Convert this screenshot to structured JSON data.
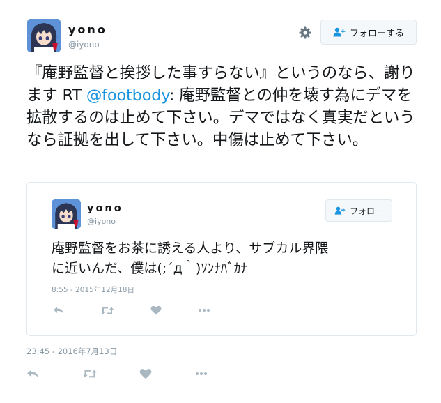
{
  "tweet": {
    "user": {
      "name": "yono",
      "handle": "@iyono"
    },
    "follow_label": "フォローする",
    "text_before_mention": "『庵野監督と挨拶した事すらない』というのなら、謝ります RT ",
    "mention": "@footbody",
    "text_after_mention": ": 庵野監督との仲を壊す為にデマを拡散するのは止めて下さい。デマではなく真実だというなら証拠を出して下さい。中傷は止めて下さい。",
    "timestamp": "23:45 - 2016年7月13日"
  },
  "quoted": {
    "user": {
      "name": "yono",
      "handle": "@iyono"
    },
    "follow_label": "フォロー",
    "text_line1": "庵野監督をお茶に誘える人より、サブカル界隈",
    "text_line2": "に近いんだ、僕は(;´д｀)ｿﾝﾅﾊﾞｶﾅ",
    "timestamp": "8:55 - 2015年12月18日"
  },
  "icons": {
    "settings": "gear-icon",
    "follow": "person-plus-icon",
    "reply": "reply-icon",
    "retweet": "retweet-icon",
    "like": "heart-icon",
    "more": "more-icon"
  },
  "colors": {
    "link": "#1b95e0",
    "secondary": "#8899a6",
    "icon": "#aab8c2"
  }
}
